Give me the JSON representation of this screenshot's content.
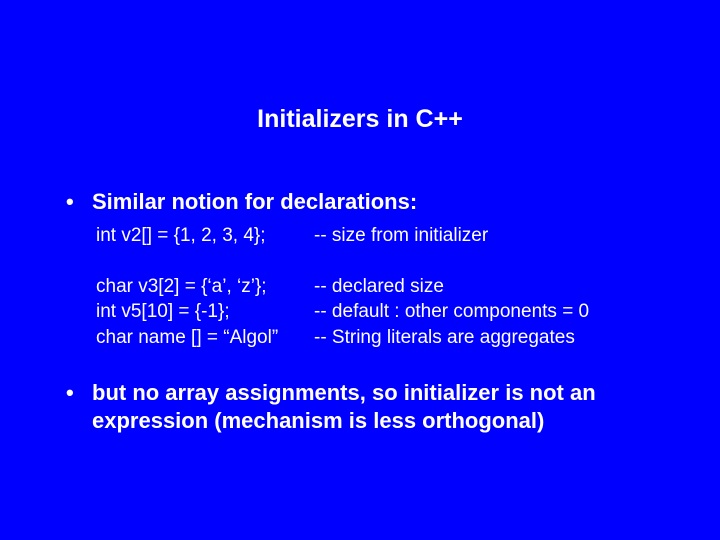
{
  "title": "Initializers in C++",
  "bullet1_text": "Similar notion for declarations:",
  "code": {
    "r1_left": "int v2[] = {1, 2, 3, 4};",
    "r1_right": "--  size from initializer",
    "r2_left": "char v3[2] = {‘a’, ‘z’};",
    "r2_right": "--  declared size",
    "r3_left": "int  v5[10]  = {-1};",
    "r3_right": "--  default : other components = 0",
    "r4_left": "char name [] = “Algol”",
    "r4_right": "--  String literals are aggregates"
  },
  "bullet2_text": "but no array assignments, so initializer is not an expression (mechanism is less orthogonal)"
}
